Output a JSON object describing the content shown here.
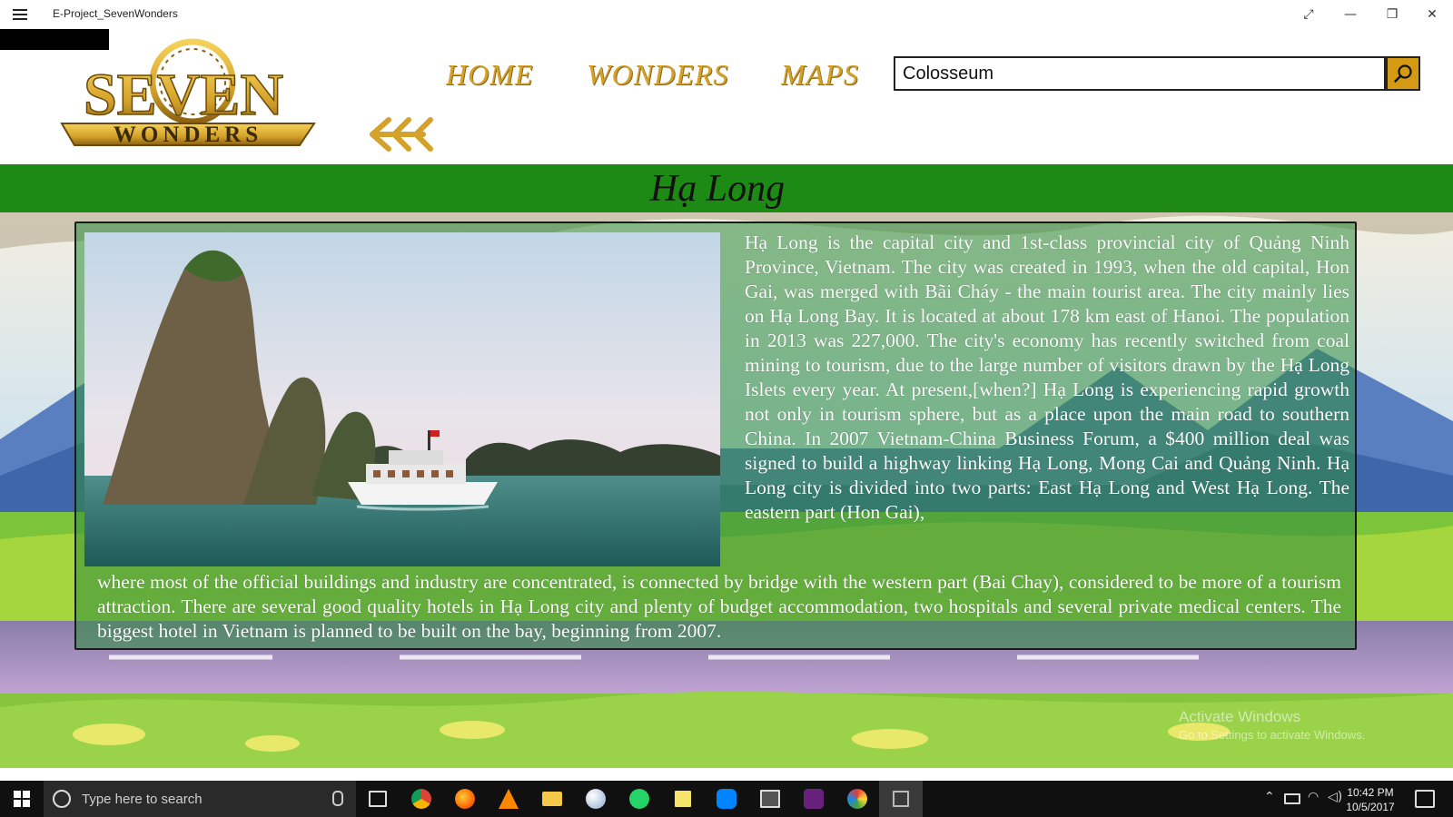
{
  "window": {
    "title": "E-Project_SevenWonders",
    "controls": {
      "fullscreen": "⤢",
      "minimize": "—",
      "restore": "❐",
      "close": "✕"
    }
  },
  "logo": {
    "line1": "SEVEN",
    "line2": "WONDERS"
  },
  "nav": {
    "home": "HOME",
    "wonders": "WONDERS",
    "maps": "MAPS",
    "back_icon": "double-arrow-left-icon"
  },
  "search": {
    "value": "Colosseum",
    "icon": "search-icon"
  },
  "page": {
    "title": "Hạ Long",
    "paragraph_top": "Hạ Long is the capital city and 1st-class provincial city of Quảng Ninh Province, Vietnam. The city was created in 1993, when the old capital, Hon Gai, was merged with Bãi Cháy - the main tourist area. The city mainly lies on Hạ Long Bay. It is located at about 178 km east of Hanoi. The population in 2013 was 227,000. The city's economy has recently switched from coal mining to tourism, due to the large number of visitors drawn by the Hạ Long Islets every year. At present,[when?] Hạ Long is experiencing rapid growth not only in tourism sphere, but as a place upon the main road to southern China. In 2007 Vietnam-China Business Forum, a $400 million deal was signed to build a highway linking Hạ Long, Mong Cai and Quảng Ninh. Hạ Long city is divided into two parts: East Hạ Long and West Hạ Long. The eastern part (Hon Gai),",
    "paragraph_bottom": "where most of the official buildings and industry are concentrated, is connected by bridge with the western part (Bai Chay), considered to be more of a tourism attraction. There are several good quality hotels in Hạ Long city and plenty of budget accommodation, two hospitals and several private medical centers. The biggest hotel in Vietnam is planned to be built on the bay, beginning from 2007."
  },
  "watermark": {
    "line1": "Activate Windows",
    "line2": "Go to Settings to activate Windows."
  },
  "taskbar": {
    "search_placeholder": "Type here to search",
    "time": "10:42 PM",
    "date": "10/5/2017",
    "apps": [
      "task-view-icon",
      "chrome-icon",
      "firefox-icon",
      "vlc-icon",
      "file-explorer-icon",
      "paint-icon",
      "whatsapp-icon",
      "sticky-notes-icon",
      "messenger-icon",
      "window-app-icon",
      "visual-studio-icon",
      "paint-app-icon",
      "active-app-icon"
    ],
    "tray": [
      "chevron-up-icon",
      "battery-icon",
      "wifi-icon",
      "volume-icon"
    ]
  },
  "colors": {
    "gold": "#d4a12a",
    "green_header": "#1e8a16",
    "search_button": "#d49a14"
  }
}
